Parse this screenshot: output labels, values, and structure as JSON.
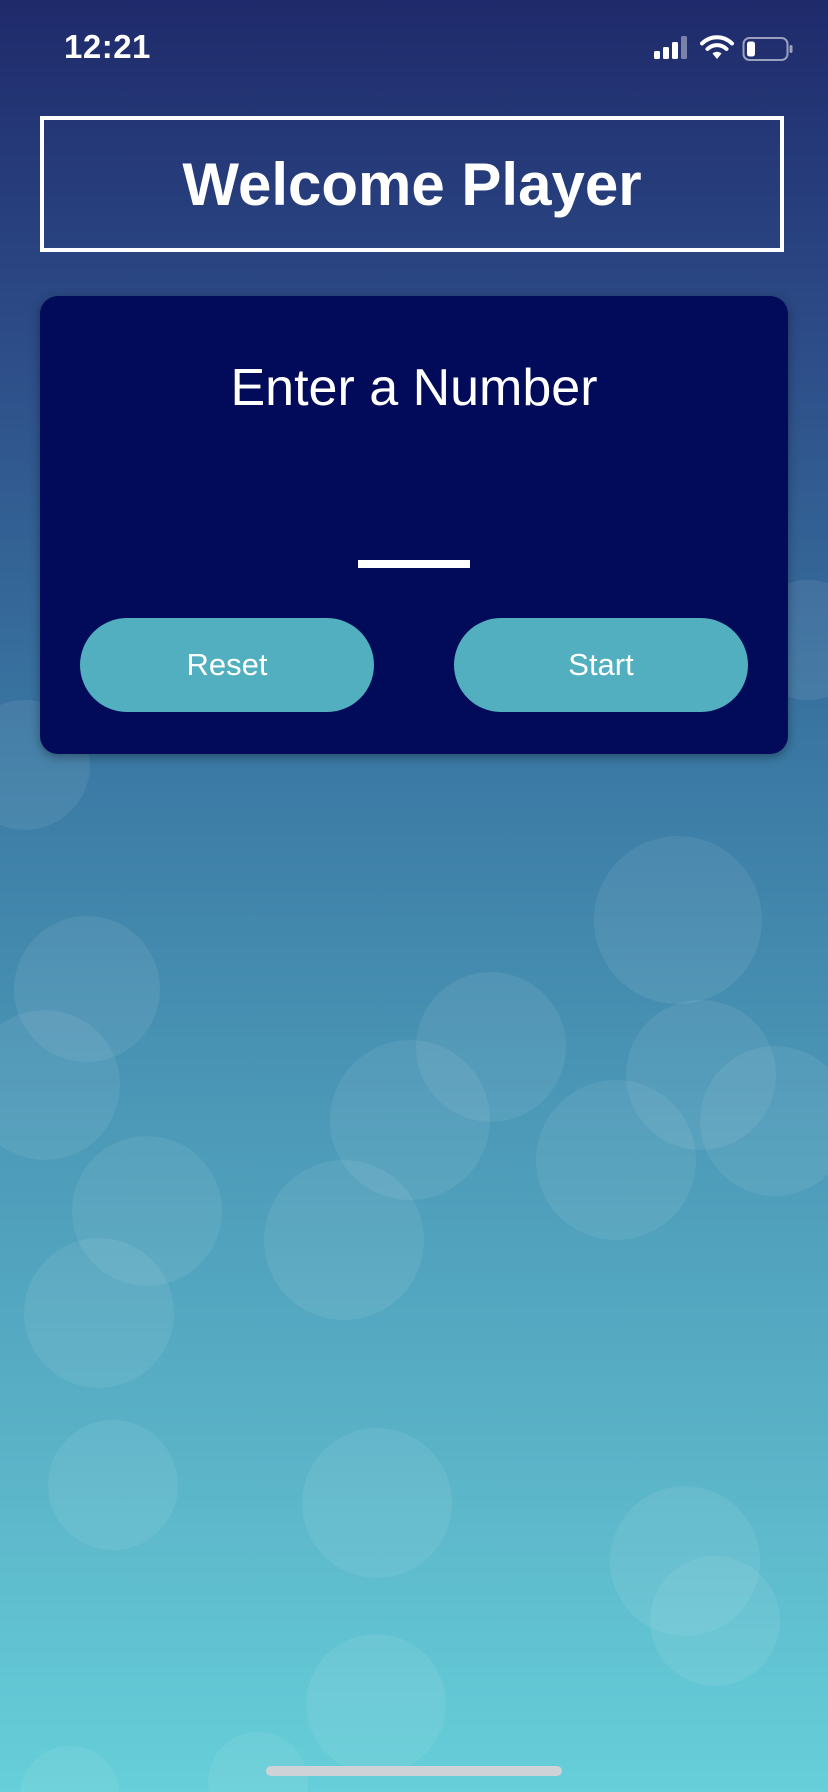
{
  "status_bar": {
    "time": "12:21",
    "icons": [
      "cellular-signal-icon",
      "wifi-icon",
      "battery-icon"
    ]
  },
  "header": {
    "title": "Welcome Player"
  },
  "card": {
    "title": "Enter a Number",
    "input": {
      "value": "",
      "placeholder": ""
    },
    "buttons": {
      "reset": "Reset",
      "start": "Start"
    }
  },
  "colors": {
    "card_background": "#020b5a",
    "button_background": "#52afbf",
    "text": "#ffffff"
  }
}
